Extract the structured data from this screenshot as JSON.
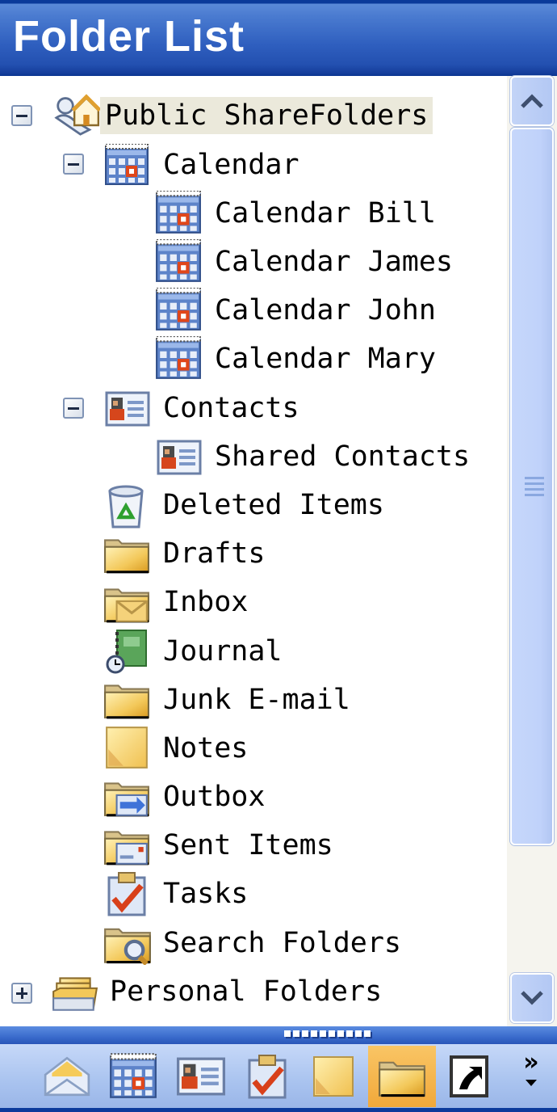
{
  "header": {
    "title": "Folder List"
  },
  "tree": {
    "root": {
      "label": "Public ShareFolders",
      "icon": "public-folders-icon",
      "expanded": true,
      "selected": true
    },
    "calendar": {
      "label": "Calendar",
      "icon": "calendar-icon",
      "expanded": true
    },
    "calendar_children": [
      {
        "label": "Calendar Bill",
        "icon": "calendar-icon"
      },
      {
        "label": "Calendar James",
        "icon": "calendar-icon"
      },
      {
        "label": "Calendar John",
        "icon": "calendar-icon"
      },
      {
        "label": "Calendar Mary",
        "icon": "calendar-icon"
      }
    ],
    "contacts": {
      "label": "Contacts",
      "icon": "contacts-icon",
      "expanded": true
    },
    "contacts_children": [
      {
        "label": "Shared Contacts",
        "icon": "contacts-icon"
      }
    ],
    "folders": [
      {
        "label": "Deleted Items",
        "icon": "deleted-items-icon"
      },
      {
        "label": "Drafts",
        "icon": "folder-icon"
      },
      {
        "label": "Inbox",
        "icon": "inbox-icon"
      },
      {
        "label": "Journal",
        "icon": "journal-icon"
      },
      {
        "label": "Junk E-mail",
        "icon": "folder-icon"
      },
      {
        "label": "Notes",
        "icon": "notes-icon"
      },
      {
        "label": "Outbox",
        "icon": "outbox-icon"
      },
      {
        "label": "Sent Items",
        "icon": "sent-items-icon"
      },
      {
        "label": "Tasks",
        "icon": "tasks-icon"
      },
      {
        "label": "Search Folders",
        "icon": "search-folders-icon"
      }
    ],
    "personal": {
      "label": "Personal Folders",
      "icon": "personal-folders-icon",
      "expanded": false
    }
  },
  "navigation_pane": {
    "buttons": [
      {
        "name": "mail",
        "icon": "mail-icon",
        "active": false
      },
      {
        "name": "calendar",
        "icon": "calendar-icon",
        "active": false
      },
      {
        "name": "contacts",
        "icon": "contacts-icon",
        "active": false
      },
      {
        "name": "tasks",
        "icon": "tasks-icon",
        "active": false
      },
      {
        "name": "notes",
        "icon": "notes-icon",
        "active": false
      },
      {
        "name": "folder-list",
        "icon": "folder-icon",
        "active": true
      },
      {
        "name": "shortcuts",
        "icon": "shortcut-icon",
        "active": false
      }
    ],
    "more_label": "»"
  },
  "colors": {
    "header_blue": "#2350b0",
    "selection_bg": "#ebe9db",
    "active_nav": "#f1a83a",
    "scrollbar": "#c0d2fa"
  }
}
